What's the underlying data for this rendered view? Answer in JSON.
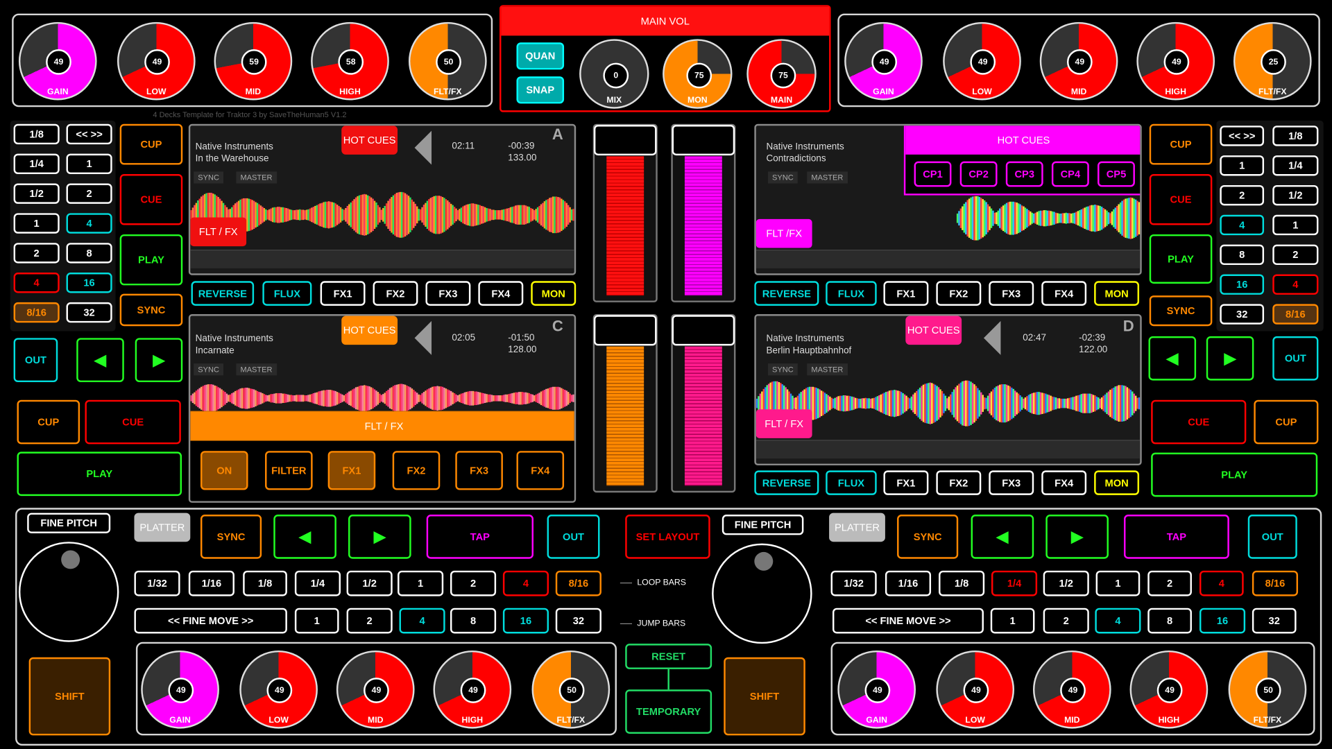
{
  "colors": {
    "magenta": "#ff00ff",
    "red": "#ff0000",
    "orange": "#ff8800",
    "green": "#22ff22",
    "cyan": "#00dddd",
    "pink": "#ff1a8c",
    "yellow": "#ffff00"
  },
  "template_credit": "4 Decks Template for Traktor 3 by SaveTheHuman5 V1.2",
  "left_eq": {
    "gain": {
      "value": "49",
      "label": "GAIN"
    },
    "low": {
      "value": "49",
      "label": "LOW"
    },
    "mid": {
      "value": "59",
      "label": "MID"
    },
    "high": {
      "value": "58",
      "label": "HIGH"
    },
    "flt": {
      "value": "50",
      "label": "FLT/FX"
    }
  },
  "right_eq": {
    "gain": {
      "value": "49",
      "label": "GAIN"
    },
    "low": {
      "value": "49",
      "label": "LOW"
    },
    "mid": {
      "value": "49",
      "label": "MID"
    },
    "high": {
      "value": "49",
      "label": "HIGH"
    },
    "flt": {
      "value": "25",
      "label": "FLT/FX"
    }
  },
  "bl_eq": {
    "gain": {
      "value": "49",
      "label": "GAIN"
    },
    "low": {
      "value": "49",
      "label": "LOW"
    },
    "mid": {
      "value": "49",
      "label": "MID"
    },
    "high": {
      "value": "49",
      "label": "HIGH"
    },
    "flt": {
      "value": "50",
      "label": "FLT/FX"
    }
  },
  "br_eq": {
    "gain": {
      "value": "49",
      "label": "GAIN"
    },
    "low": {
      "value": "49",
      "label": "LOW"
    },
    "mid": {
      "value": "49",
      "label": "MID"
    },
    "high": {
      "value": "49",
      "label": "HIGH"
    },
    "flt": {
      "value": "50",
      "label": "FLT/FX"
    }
  },
  "main_vol": {
    "title": "MAIN VOL",
    "quan": "QUAN",
    "snap": "SNAP",
    "mix": {
      "value": "0",
      "label": "MIX"
    },
    "mon": {
      "value": "75",
      "label": "MON"
    },
    "main": {
      "value": "75",
      "label": "MAIN"
    }
  },
  "deck_a": {
    "artist": "Native Instruments",
    "title": "In the Warehouse",
    "elapsed": "02:11",
    "remain": "-00:39",
    "bpm": "133.00",
    "letter": "A",
    "sync": "SYNC",
    "master": "MASTER",
    "hotcues": "HOT CUES",
    "fltfx": "FLT / FX"
  },
  "deck_b": {
    "artist": "Native Instruments",
    "title": "Contradictions",
    "sync": "SYNC",
    "master": "MASTER",
    "hotcues": "HOT CUES",
    "fltfx": "FLT /FX",
    "cps": [
      "CP1",
      "CP2",
      "CP3",
      "CP4",
      "CP5"
    ]
  },
  "deck_c": {
    "artist": "Native Instruments",
    "title": "Incarnate",
    "elapsed": "02:05",
    "remain": "-01:50",
    "bpm": "128.00",
    "letter": "C",
    "sync": "SYNC",
    "master": "MASTER",
    "hotcues": "HOT CUES",
    "fltfx": "FLT / FX",
    "fx_buttons": [
      "ON",
      "FILTER",
      "FX1",
      "FX2",
      "FX3",
      "FX4"
    ]
  },
  "deck_d": {
    "artist": "Native Instruments",
    "title": "Berlin Hauptbahnhof",
    "elapsed": "02:47",
    "remain": "-02:39",
    "bpm": "122.00",
    "letter": "D",
    "sync": "SYNC",
    "master": "MASTER",
    "hotcues": "HOT CUES",
    "fltfx": "FLT / FX"
  },
  "fx_row": [
    "REVERSE",
    "FLUX",
    "FX1",
    "FX2",
    "FX3",
    "FX4",
    "MON"
  ],
  "left_loops": {
    "col1": [
      "1/8",
      "1/4",
      "1/2",
      "1",
      "2",
      "4",
      "8/16"
    ],
    "col2": [
      "<< >>",
      "1",
      "2",
      "4",
      "8",
      "16",
      "32"
    ]
  },
  "right_loops": {
    "col1": [
      "<< >>",
      "1",
      "2",
      "4",
      "8",
      "16",
      "32"
    ],
    "col2": [
      "1/8",
      "1/4",
      "1/2",
      "1",
      "2",
      "4",
      "8/16"
    ]
  },
  "transport": {
    "cup": "CUP",
    "cue": "CUE",
    "play": "PLAY",
    "sync": "SYNC",
    "out": "OUT",
    "prev": "◀",
    "next": "▶"
  },
  "bottom": {
    "fine_pitch": "FINE PITCH",
    "platter": "PLATTER",
    "sync": "SYNC",
    "tap": "TAP",
    "out": "OUT",
    "prev": "◀",
    "next": "▶",
    "loop_row": [
      "1/32",
      "1/16",
      "1/8",
      "1/4",
      "1/2",
      "1",
      "2",
      "4",
      "8/16"
    ],
    "fine_move": "<<  FINE MOVE  >>",
    "jump_row": [
      "1",
      "2",
      "4",
      "8",
      "16",
      "32"
    ],
    "shift": "SHIFT"
  },
  "center": {
    "set_layout": "SET LAYOUT",
    "loop_bars": "LOOP BARS",
    "jump_bars": "JUMP BARS",
    "reset": "RESET",
    "temporary": "TEMPORARY"
  }
}
